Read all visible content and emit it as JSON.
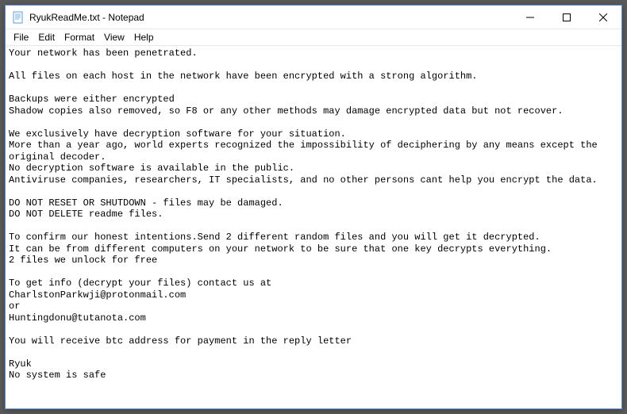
{
  "titlebar": {
    "title": "RyukReadMe.txt - Notepad"
  },
  "menubar": {
    "file": "File",
    "edit": "Edit",
    "format": "Format",
    "view": "View",
    "help": "Help"
  },
  "document": {
    "text": "Your network has been penetrated.\n\nAll files on each host in the network have been encrypted with a strong algorithm.\n\nBackups were either encrypted\nShadow copies also removed, so F8 or any other methods may damage encrypted data but not recover.\n\nWe exclusively have decryption software for your situation.\nMore than a year ago, world experts recognized the impossibility of deciphering by any means except the original decoder.\nNo decryption software is available in the public.\nAntiviruse companies, researchers, IT specialists, and no other persons cant help you encrypt the data.\n\nDO NOT RESET OR SHUTDOWN - files may be damaged.\nDO NOT DELETE readme files.\n\nTo confirm our honest intentions.Send 2 different random files and you will get it decrypted.\nIt can be from different computers on your network to be sure that one key decrypts everything.\n2 files we unlock for free\n\nTo get info (decrypt your files) contact us at\nCharlstonParkwji@protonmail.com\nor\nHuntingdonu@tutanota.com\n\nYou will receive btc address for payment in the reply letter\n\nRyuk\nNo system is safe"
  }
}
